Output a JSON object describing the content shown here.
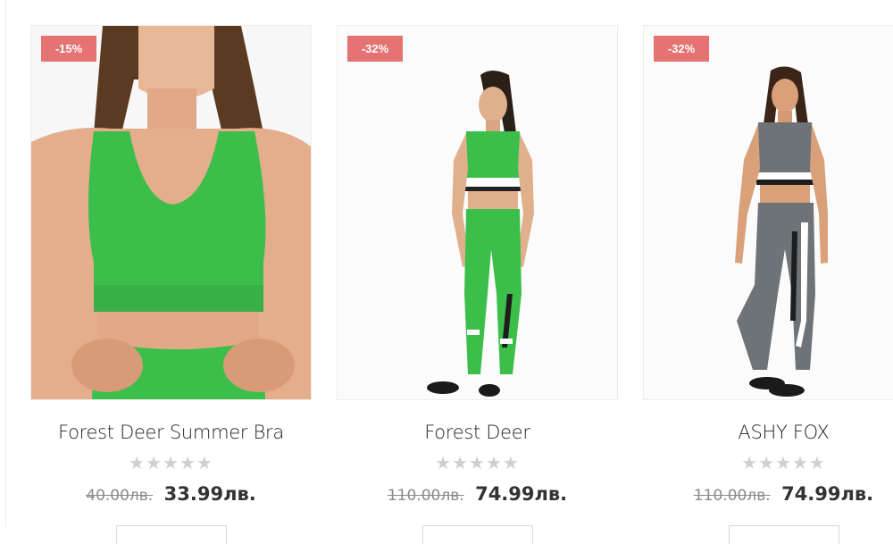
{
  "products": [
    {
      "title": "Forest Deer Summer Bra",
      "badge": "-15%",
      "old_price": "40.00лв.",
      "new_price": "33.99лв.",
      "rating": "★★★★★",
      "image": "green-sports-bra-photo"
    },
    {
      "title": "Forest Deer",
      "badge": "-32%",
      "old_price": "110.00лв.",
      "new_price": "74.99лв.",
      "rating": "★★★★★",
      "image": "green-sport-set-photo"
    },
    {
      "title": "ASHY FOX",
      "badge": "-32%",
      "old_price": "110.00лв.",
      "new_price": "74.99лв.",
      "rating": "★★★★★",
      "image": "grey-sport-set-photo"
    }
  ],
  "colors": {
    "badge": "#e57373",
    "green": "#3cbf4a",
    "grey": "#6e7377"
  }
}
